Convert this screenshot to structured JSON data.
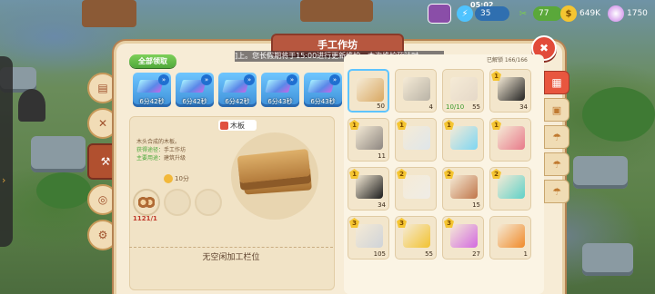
{
  "hud": {
    "time": "05:02",
    "energy": "35",
    "tools": "77",
    "gold": "649K",
    "gems": "1750"
  },
  "window": {
    "title": "手工作坊",
    "notice": "]上。您长假期将于15:00进行更新维护，本次维护预计时",
    "collect_all": "全部领取",
    "unlocked": "已解锁 166/166"
  },
  "slots": [
    {
      "timer": "6分42秒"
    },
    {
      "timer": "6分42秒"
    },
    {
      "timer": "6分42秒"
    },
    {
      "timer": "6分43秒"
    },
    {
      "timer": "6分43秒"
    }
  ],
  "detail": {
    "name": "木板",
    "description": "木头合成的木板。",
    "source_label": "获得途径：",
    "source_value": "手工作坊",
    "use_label": "主要用途：",
    "use_value": "建筑升级",
    "time": "10分",
    "material_qty": "1121/1",
    "queue_message": "无空闲加工栏位"
  },
  "grid": [
    {
      "name": "plank-item",
      "qty": "50",
      "level": "",
      "color": "#d9a862",
      "selected": true
    },
    {
      "name": "stone-brick-item",
      "qty": "4",
      "level": "",
      "color": "#b9b3a6"
    },
    {
      "name": "hammer-item",
      "qty": "55",
      "level": "",
      "color": "#e5d8c8",
      "extra": "10/10"
    },
    {
      "name": "coal-item",
      "qty": "34",
      "level": "1",
      "color": "#222"
    },
    {
      "name": "iron-block-item",
      "qty": "11",
      "level": "1",
      "color": "#8d8680"
    },
    {
      "name": "nails-item",
      "qty": "",
      "level": "1",
      "color": "#dfe6ea"
    },
    {
      "name": "glass-item",
      "qty": "",
      "level": "1",
      "color": "#7ed6f2"
    },
    {
      "name": "ribbon-item",
      "qty": "",
      "level": "1",
      "color": "#e87a8a"
    },
    {
      "name": "coal-item-2",
      "qty": "34",
      "level": "1",
      "color": "#1c1c1c"
    },
    {
      "name": "paper-roll-item",
      "qty": "",
      "level": "2",
      "color": "#efece6"
    },
    {
      "name": "copper-ingot-item",
      "qty": "15",
      "level": "2",
      "color": "#c0764a"
    },
    {
      "name": "cloud-block-item",
      "qty": "",
      "level": "2",
      "color": "#5fd1c8"
    },
    {
      "name": "silver-ingot-item",
      "qty": "105",
      "level": "3",
      "color": "#cfd3d8"
    },
    {
      "name": "gold-ingot-item",
      "qty": "55",
      "level": "3",
      "color": "#f2c230"
    },
    {
      "name": "rainbow-ingot-item",
      "qty": "27",
      "level": "3",
      "color": "#d26ae0"
    },
    {
      "name": "pumpkin-item",
      "qty": "1",
      "level": "",
      "color": "#f08a2a"
    }
  ]
}
